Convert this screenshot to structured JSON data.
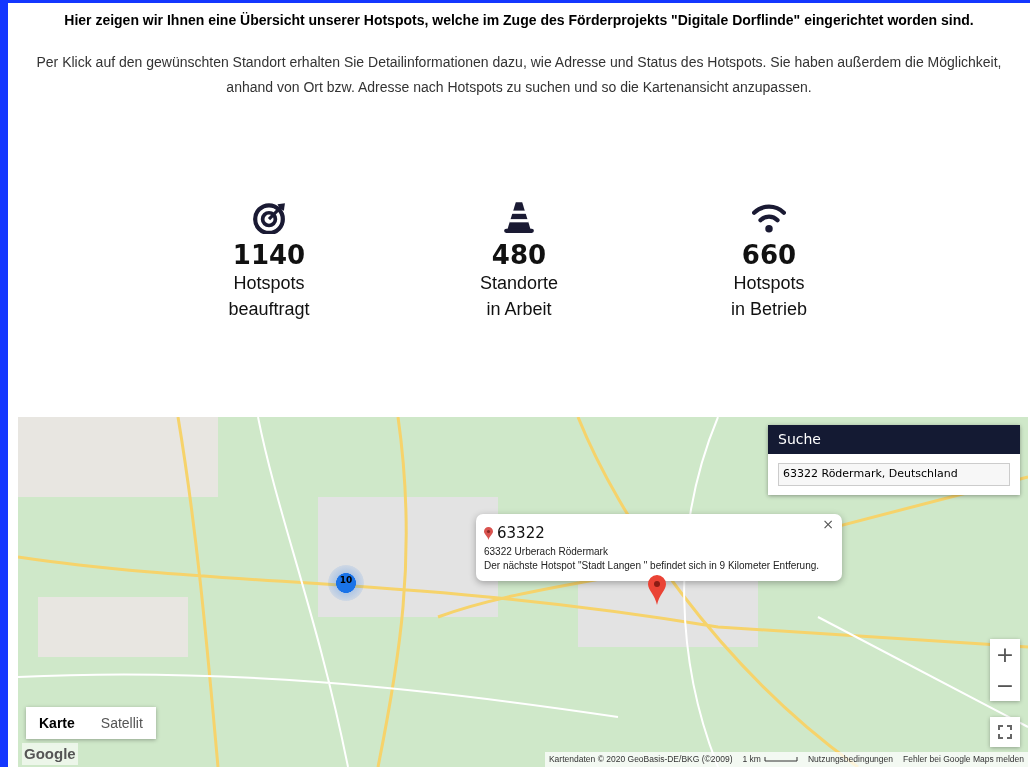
{
  "intro": {
    "heading": "Hier zeigen wir Ihnen eine Übersicht unserer Hotspots, welche im Zuge des Förderprojekts \"Digitale Dorflinde\" eingerichtet worden sind.",
    "text": "Per Klick auf den gewünschten Standort erhalten Sie Detailinformationen dazu, wie Adresse und Status des Hotspots. Sie haben außerdem die Möglichkeit, anhand von Ort bzw. Adresse nach Hotspots zu suchen und so die Kartenansicht anzupassen."
  },
  "stats": [
    {
      "kind": "target",
      "value": "1140",
      "line1": "Hotspots",
      "line2": "beauftragt"
    },
    {
      "kind": "cone",
      "value": "480",
      "line1": "Standorte",
      "line2": "in Arbeit"
    },
    {
      "kind": "wifi",
      "value": "660",
      "line1": "Hotspots",
      "line2": "in Betrieb"
    }
  ],
  "map": {
    "search": {
      "title": "Suche",
      "value": "63322 Rödermark, Deutschland"
    },
    "popup": {
      "title": "63322",
      "address": "63322 Urberach Rödermark",
      "text": "Der nächste Hotspot \"Stadt Langen \" befindet sich in 9 Kilometer Entferung.",
      "close": "×"
    },
    "cluster": {
      "count": "10"
    },
    "map_types": [
      {
        "label": "Karte",
        "selected": true
      },
      {
        "label": "Satellit",
        "selected": false
      }
    ],
    "zoom": {
      "in": "+",
      "out": "−"
    },
    "logo": "Google",
    "footer": {
      "attribution": "Kartendaten © 2020 GeoBasis-DE/BKG (©2009)",
      "scale": "1 km",
      "terms": "Nutzungsbedingungen",
      "report": "Fehler bei Google Maps melden"
    }
  }
}
